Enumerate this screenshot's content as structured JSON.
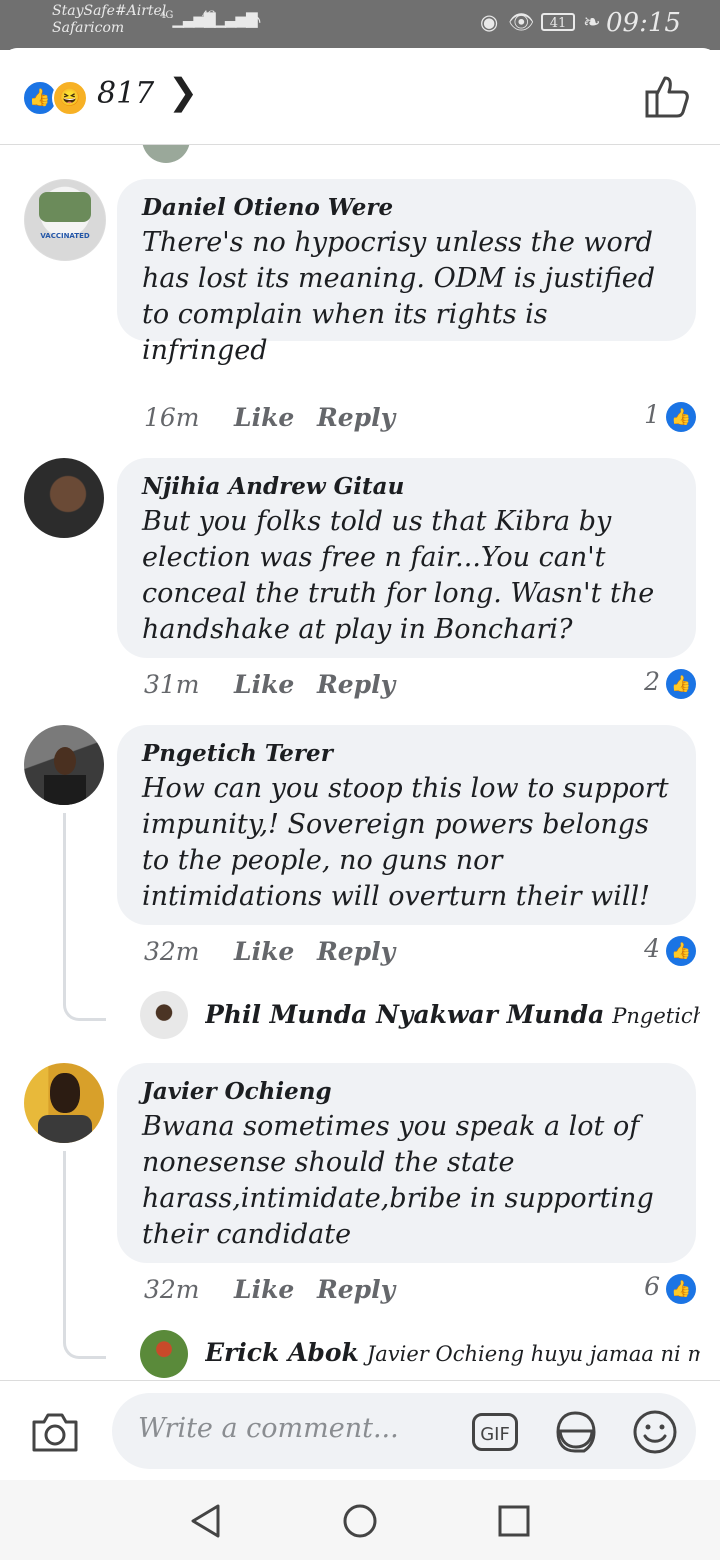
{
  "status_bar": {
    "carrier_1": "StaySafe#Airtel",
    "carrier_2": "Safaricom",
    "signal_1": "4G",
    "signal_2": "4G",
    "battery": "41",
    "time": "09:15"
  },
  "header": {
    "reaction_count": "817",
    "icons": [
      "like-reaction-icon",
      "haha-reaction-icon",
      "chevron-right-icon",
      "thumbs-up-outline-icon"
    ]
  },
  "comments": [
    {
      "author": "Daniel Otieno Were",
      "text": "There's no hypocrisy unless the word has lost its meaning. ODM is justified to complain when its rights is infringed",
      "time": "16m",
      "like_label": "Like",
      "reply_label": "Reply",
      "likes": "1"
    },
    {
      "author": "Njihia Andrew Gitau",
      "text": "But you folks told us that Kibra by election was free n fair...You can't conceal the truth for long. Wasn't the handshake at play in Bonchari?",
      "time": "31m",
      "like_label": "Like",
      "reply_label": "Reply",
      "likes": "2"
    },
    {
      "author": "Pngetich Terer",
      "text": "How can you stoop this low to support impunity,! Sovereign powers belongs to the people, no guns nor intimidations will overturn their will!",
      "time": "32m",
      "like_label": "Like",
      "reply_label": "Reply",
      "likes": "4",
      "reply_preview": {
        "author": "Phil Munda Nyakwar Munda",
        "text": "Pngetich Terer e..."
      }
    },
    {
      "author": "Javier Ochieng",
      "text": "Bwana sometimes you speak a lot of nonesense should the state harass,intimidate,bribe in supporting their candidate",
      "time": "32m",
      "like_label": "Like",
      "reply_label": "Reply",
      "likes": "6",
      "reply_preview": {
        "author": "Erick Abok",
        "text": "Javier Ochieng huyu jamaa ni mjing..."
      }
    }
  ],
  "composer": {
    "placeholder": "Write a comment...",
    "gif_label": "GIF"
  },
  "colors": {
    "facebook_blue": "#1b74e4",
    "bubble_bg": "#f0f2f5",
    "meta_gray": "#65676b"
  }
}
